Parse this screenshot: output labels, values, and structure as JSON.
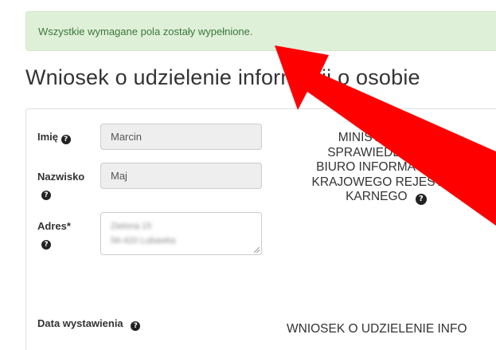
{
  "alert": {
    "message": "Wszystkie wymagane pola zostały wypełnione."
  },
  "page": {
    "title": "Wniosek o udzielenie informacji o osobie"
  },
  "form": {
    "first_name": {
      "label": "Imię",
      "value": "Marcin"
    },
    "last_name": {
      "label": "Nazwisko",
      "value": "Maj"
    },
    "address": {
      "label": "Adres*",
      "line1": "Zielona 15",
      "line2": "56-420 Lubawka"
    },
    "issue_date": {
      "label": "Data wystawienia"
    }
  },
  "recipient": {
    "lines": [
      "MINISTERSTWO",
      "SPRAWIEDLIWOŚCI",
      "BIURO INFORMACYJNE",
      "KRAJOWEGO REJESTRU",
      "KARNEGO"
    ]
  },
  "document": {
    "heading": "WNIOSEK O UDZIELENIE INFO"
  },
  "icons": {
    "help": "question-circle-icon",
    "annotation": "red-arrow-icon"
  },
  "colors": {
    "alert_bg": "#dff0d8",
    "alert_text": "#3c763d",
    "arrow": "#ff0000"
  }
}
